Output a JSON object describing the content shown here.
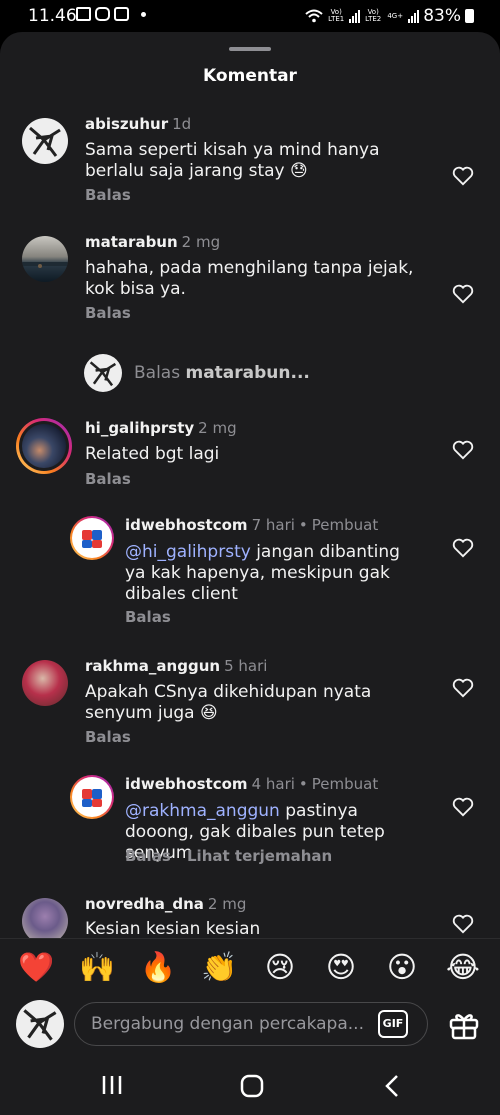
{
  "status": {
    "time": "11.46",
    "net1": "Vo) LTE1",
    "net2": "Vo) LTE2",
    "net3": "4G+",
    "battery": "83%"
  },
  "sheet": {
    "title": "Komentar"
  },
  "comments": [
    {
      "user": "abiszuhur",
      "time": "1d",
      "text": "Sama seperti kisah ya mind hanya berlalu saja jarang stay 😓",
      "reply": "Balas"
    },
    {
      "user": "matarabun",
      "time": "2 mg",
      "text": "hahaha, pada menghilang tanpa jejak, kok bisa ya.",
      "reply": "Balas"
    },
    {
      "user": "hi_galihprsty",
      "time": "2 mg",
      "text": "Related bgt lagi",
      "reply": "Balas"
    },
    {
      "user": "idwebhostcom",
      "time": "7 hari",
      "badge": "Pembuat",
      "mention": "@hi_galihprsty",
      "text": " jangan dibanting ya kak hapenya, meskipun gak dibales client",
      "reply": "Balas"
    },
    {
      "user": "rakhma_anggun",
      "time": "5 hari",
      "text": "Apakah CSnya dikehidupan nyata senyum juga 😆",
      "reply": "Balas"
    },
    {
      "user": "idwebhostcom",
      "time": "4 hari",
      "badge": "Pembuat",
      "mention": "@rakhma_anggun",
      "text": " pastinya dooong, gak dibales pun tetep senyum",
      "reply": "Balas",
      "translate": "Lihat terjemahan"
    },
    {
      "user": "novredha_dna",
      "time": "2 mg",
      "text": "Kesian kesian kesian"
    }
  ],
  "reply_prompt": {
    "prefix": "Balas",
    "user": "matarabun..."
  },
  "emojis": [
    "❤️",
    "🙌",
    "🔥",
    "👏",
    "😢",
    "😍",
    "😮",
    "😂"
  ],
  "composer": {
    "placeholder": "Bergabung dengan percakapa...",
    "gif_label": "GIF"
  },
  "icons": {
    "like": "heart-icon",
    "gift": "gift-icon",
    "nav_recents": "recents-icon",
    "nav_home": "home-icon",
    "nav_back": "back-icon"
  },
  "colors": {
    "sheet_bg": "#1c1c1e",
    "mention": "#9fb2ff",
    "muted": "#8e8e93",
    "story_ring": "#e1306c"
  }
}
